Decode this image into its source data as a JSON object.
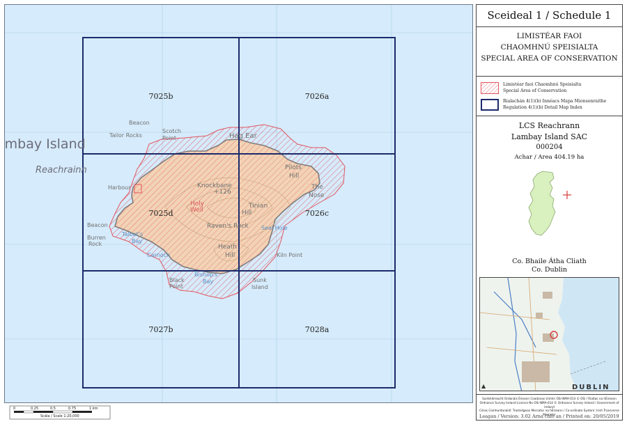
{
  "map": {
    "place_labels": {
      "island_name": "ambay Island",
      "irish_name": "Reachrainn",
      "beacon_north": "Beacon",
      "tailor_rocks": "Tailor Rocks",
      "scotch": "Scotch",
      "point": "Point",
      "harbour": "Harbour",
      "beacon_west": "Beacon",
      "burren": "Burren",
      "rock": "Rock",
      "knockbane": "Knockbane",
      "height": "+126",
      "holy": "Holy",
      "well": "Well",
      "tinian": "Tinian",
      "hill": "Hill",
      "ravens_rock": "Raven's Rock",
      "heath": "Heath",
      "heath_hill": "Hill",
      "kiln_point": "Kiln Point",
      "black": "Black",
      "black_point": "Point",
      "seal_hole": "Seal Hole",
      "the_nose_1": "The",
      "the_nose_2": "Nose",
      "pilots": "Pilots",
      "pilots_hill": "Hill",
      "hag_ear": "Hag Ear",
      "talbots": "Talbot's",
      "bay": "Bay",
      "carnoch": "Carnoch",
      "sunk": "Sunk",
      "island": "Island",
      "bishops_bay": "Bishop's",
      "bishops_bay2": "Bay"
    },
    "grid_labels": [
      "7025b",
      "7026a",
      "7025d",
      "7026c",
      "7027b",
      "7028a"
    ],
    "colors": {
      "sea": "#d6ebfb",
      "land": "#f2d3b5",
      "hatch": "#e2555f",
      "grid": "#1b2a6b",
      "boundary": "#e2555f"
    }
  },
  "scalebar": {
    "ticks": [
      "0",
      "0.25",
      "0.5",
      "0.75",
      "1 km"
    ],
    "caption": "Scála / Scale 1:20,000"
  },
  "legend": {
    "title": "Sceideal 1 / Schedule 1",
    "designation_ga_1": "LIMISTÉAR FAOI",
    "designation_ga_2": "CHAOMHNÚ SPEISIALTA",
    "designation_en": "SPECIAL AREA OF CONSERVATION",
    "key_sac_ga": "Limistéar faoi Chaomhnú Speisialta",
    "key_sac_en": "Special Area of Conservation",
    "key_grid_ga": "Rialachán 4(1)(b) Innéacs Mapa Mionsonraithe",
    "key_grid_en": "Regulation 4(1)(b) Detail Map Index",
    "site_ga": "LCS Reachrann",
    "site_en": "Lambay Island SAC",
    "site_code": "000204",
    "area": "Achar / Area 404.19 ha",
    "county_ga": "Co. Bhaile Átha Cliath",
    "county_en": "Co. Dublin",
    "inset_city": "DUBLIN",
    "credits_1": "Suirbhéireacht Ordanáis Éireann Ceadúnas Uimhir OSi-NMA-014 © OSi / Rialtas na hÉireann",
    "credits_2": "Ordnance Survey Ireland Licence No OSi-NMA-014 © Ordnance Survey Ireland / Government of Ireland",
    "credits_3": "Córas Comhordanáidí: Tras­teilgean Mercator na hÉireann / Co-ordinate System: Irish Transverse Mercator",
    "version": "Leagan / Version: 3.02",
    "printed": "Arna chló an / Printed on: 20/05/2019"
  }
}
